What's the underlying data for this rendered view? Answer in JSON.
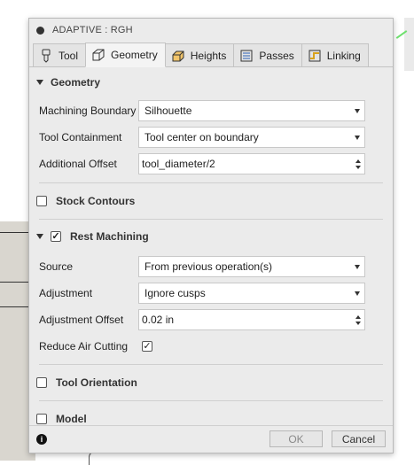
{
  "title": "ADAPTIVE : RGH",
  "tabs": [
    {
      "label": "Tool",
      "icon": "tool-icon"
    },
    {
      "label": "Geometry",
      "icon": "geometry-cube-icon"
    },
    {
      "label": "Heights",
      "icon": "heights-icon"
    },
    {
      "label": "Passes",
      "icon": "passes-icon"
    },
    {
      "label": "Linking",
      "icon": "linking-icon"
    }
  ],
  "active_tab": "Geometry",
  "geometry": {
    "header": "Geometry",
    "machining_boundary": {
      "label": "Machining Boundary",
      "value": "Silhouette"
    },
    "tool_containment": {
      "label": "Tool Containment",
      "value": "Tool center on boundary"
    },
    "additional_offset": {
      "label": "Additional Offset",
      "value": "tool_diameter/2"
    }
  },
  "stock_contours": {
    "label": "Stock Contours",
    "checked": false
  },
  "rest_machining": {
    "label": "Rest Machining",
    "checked": true,
    "source": {
      "label": "Source",
      "value": "From previous operation(s)"
    },
    "adjustment": {
      "label": "Adjustment",
      "value": "Ignore cusps"
    },
    "adjustment_offset": {
      "label": "Adjustment Offset",
      "value": "0.02 in"
    },
    "reduce_air_cutting": {
      "label": "Reduce Air Cutting",
      "checked": true
    }
  },
  "tool_orientation": {
    "label": "Tool Orientation",
    "checked": false
  },
  "model": {
    "label": "Model",
    "checked": false
  },
  "footer": {
    "ok": "OK",
    "cancel": "Cancel",
    "info_icon": "i"
  }
}
